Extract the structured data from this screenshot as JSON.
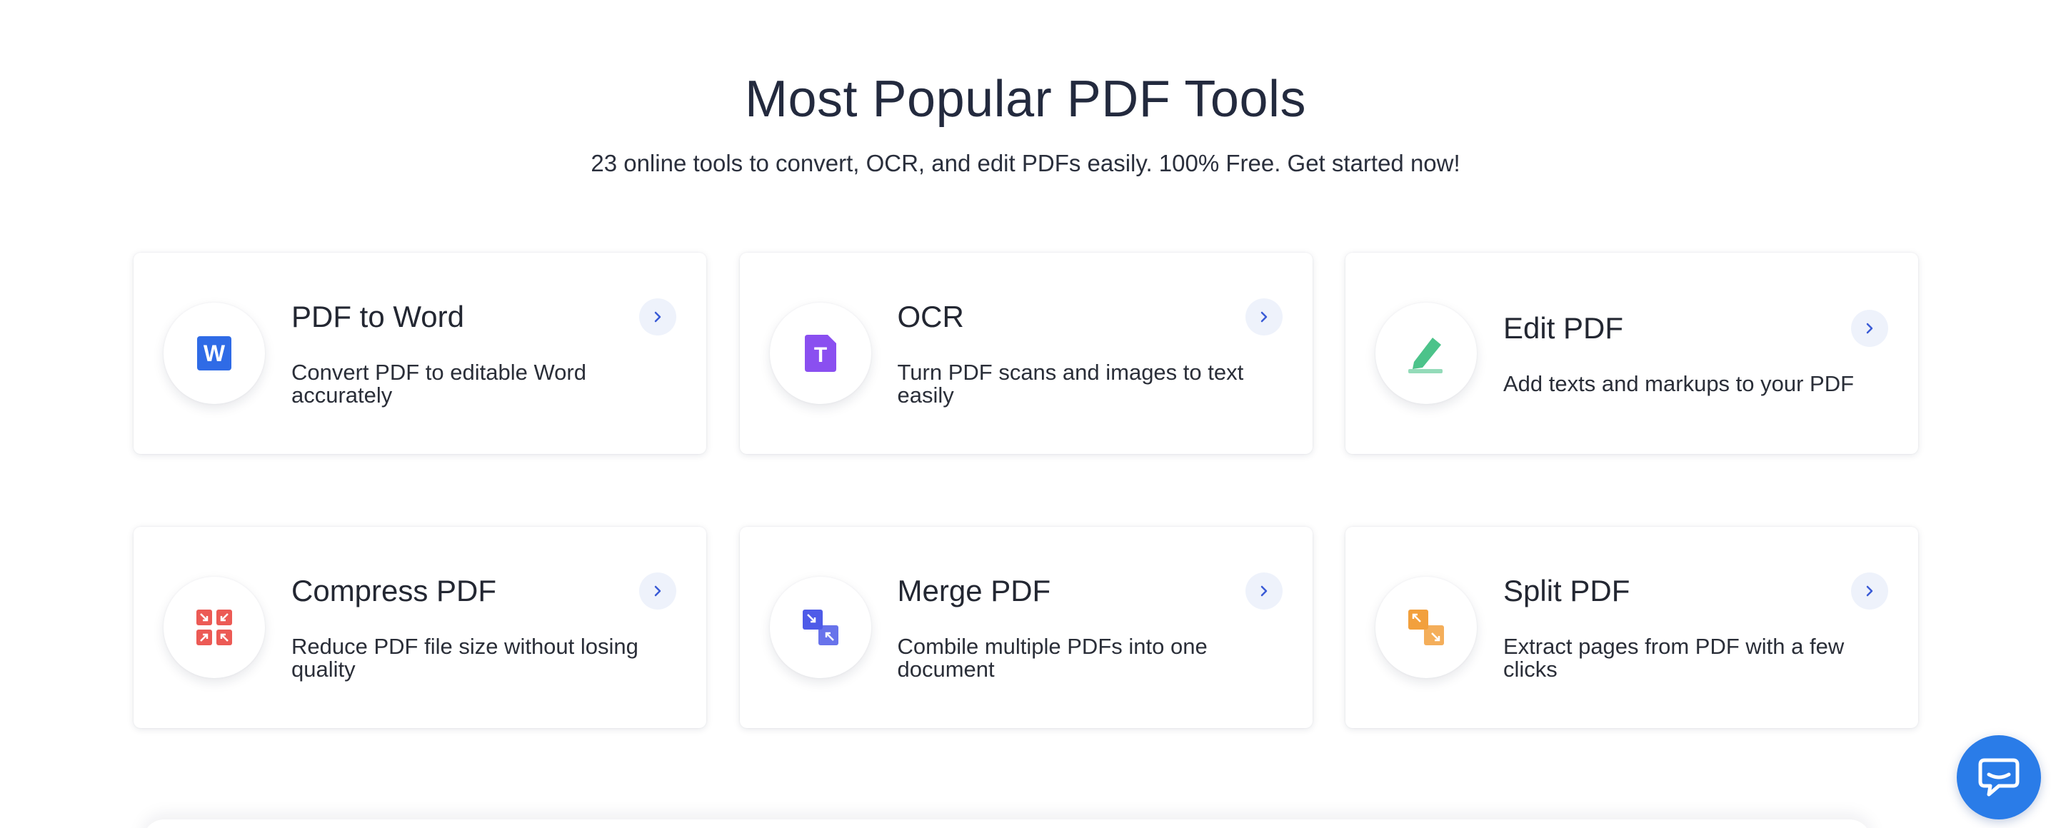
{
  "header": {
    "title": "Most Popular PDF Tools",
    "subtitle": "23 online tools to convert, OCR, and edit PDFs easily. 100% Free. Get started now!"
  },
  "tools": [
    {
      "title": "PDF to Word",
      "description": "Convert PDF to editable Word accurately",
      "icon": "word-icon",
      "icon_letter": "W",
      "color": "#2f6be6"
    },
    {
      "title": "OCR",
      "description": "Turn PDF scans and images to text easily",
      "icon": "ocr-icon",
      "icon_letter": "T",
      "color": "#8a4ff0"
    },
    {
      "title": "Edit PDF",
      "description": "Add texts and markups to your PDF",
      "icon": "edit-pen-icon",
      "color": "#4cc38a"
    },
    {
      "title": "Compress PDF",
      "description": "Reduce PDF file size without losing quality",
      "icon": "compress-icon",
      "color": "#ec5a55"
    },
    {
      "title": "Merge PDF",
      "description": "Combile multiple PDFs into one document",
      "icon": "merge-icon",
      "color": "#4e5be8"
    },
    {
      "title": "Split PDF",
      "description": "Extract pages from PDF with a few clicks",
      "icon": "split-icon",
      "color": "#f2a03d"
    }
  ],
  "chat": {
    "icon": "chat-bubble-icon",
    "color": "#2a7ce8"
  }
}
